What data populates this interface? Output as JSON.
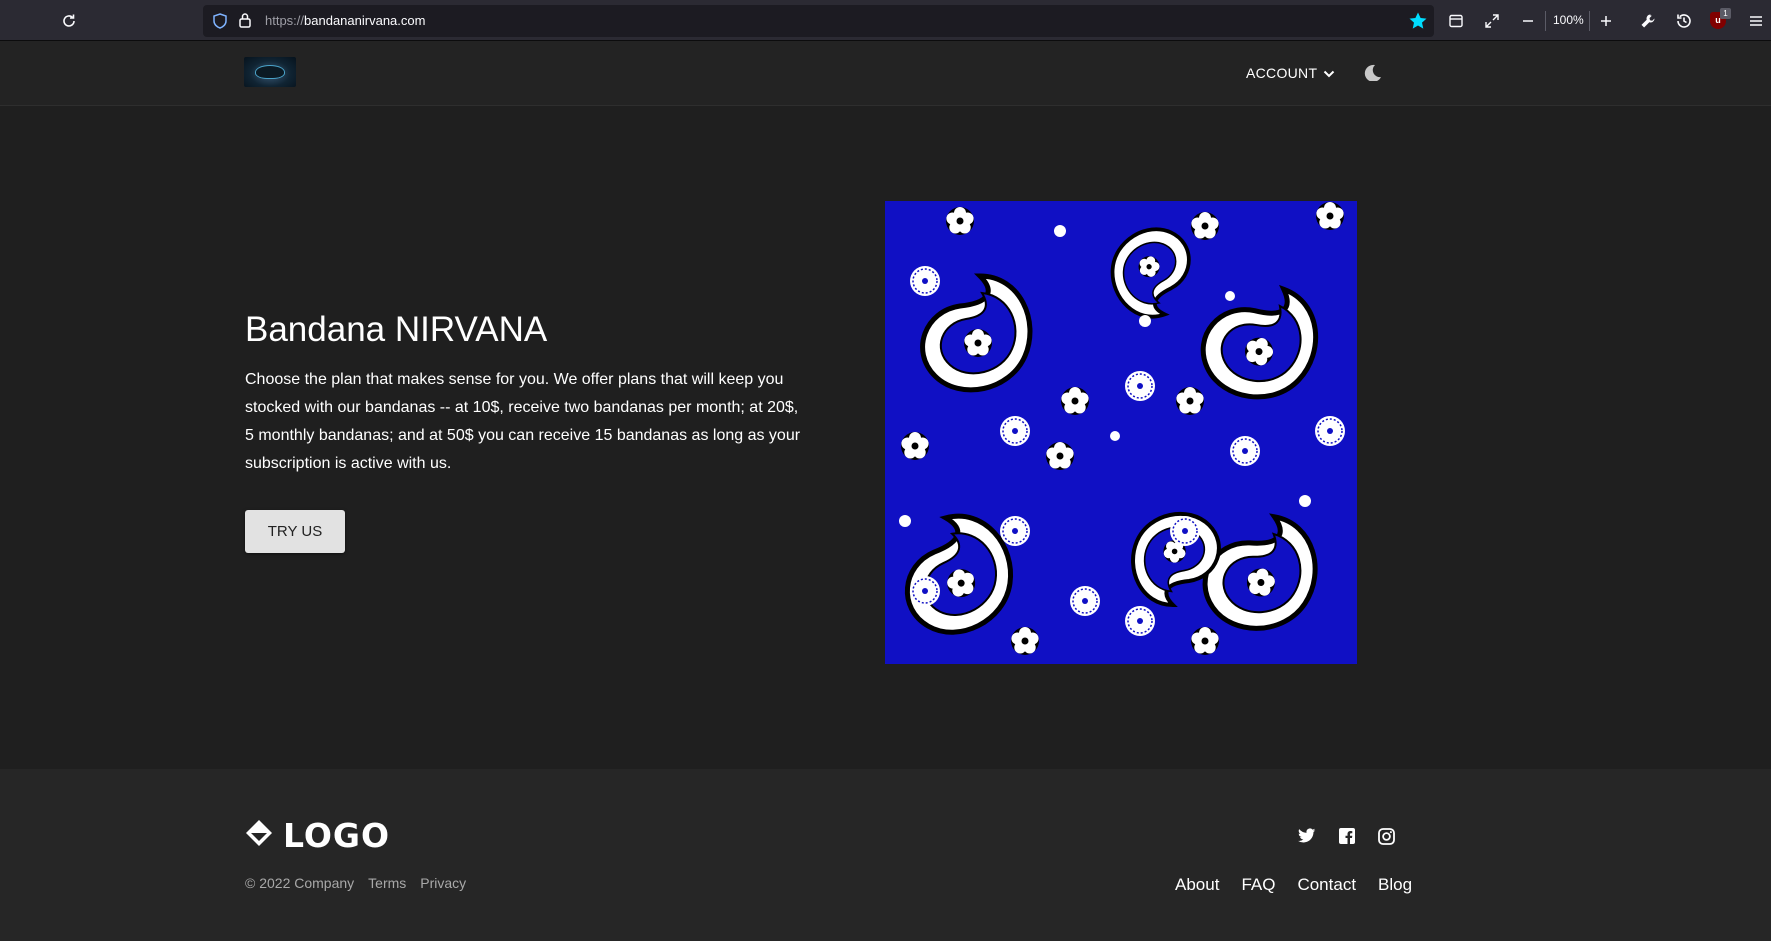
{
  "browser": {
    "url_protocol": "https://",
    "url_host": "bandananirvana.com",
    "zoom": "100%",
    "extension_badge_count": "1",
    "extension_label": "u"
  },
  "header": {
    "account_label": "ACCOUNT"
  },
  "hero": {
    "title": "Bandana NIRVANA",
    "description": "Choose the plan that makes sense for you. We offer plans that will keep you stocked with our bandanas -- at 10$, receive two bandanas per month; at 20$, 5 monthly bandanas; and at 50$ you can receive 15 bandanas as long as your subscription is active with us.",
    "cta_label": "TRY US",
    "image_colors": {
      "background": "#1010c4",
      "motif": "#ffffff",
      "outline": "#000000"
    }
  },
  "footer": {
    "logo_text": "LOGO",
    "copyright": "© 2022 Company",
    "legal_links": [
      "Terms",
      "Privacy"
    ],
    "social_icons": [
      "twitter-icon",
      "facebook-icon",
      "instagram-icon"
    ],
    "nav_links": [
      "About",
      "FAQ",
      "Contact",
      "Blog"
    ]
  },
  "colors": {
    "page_background": "#1f1f1f",
    "footer_background": "#262626",
    "button_background": "#e2e2e2",
    "bookmark_star": "#00ddff"
  }
}
